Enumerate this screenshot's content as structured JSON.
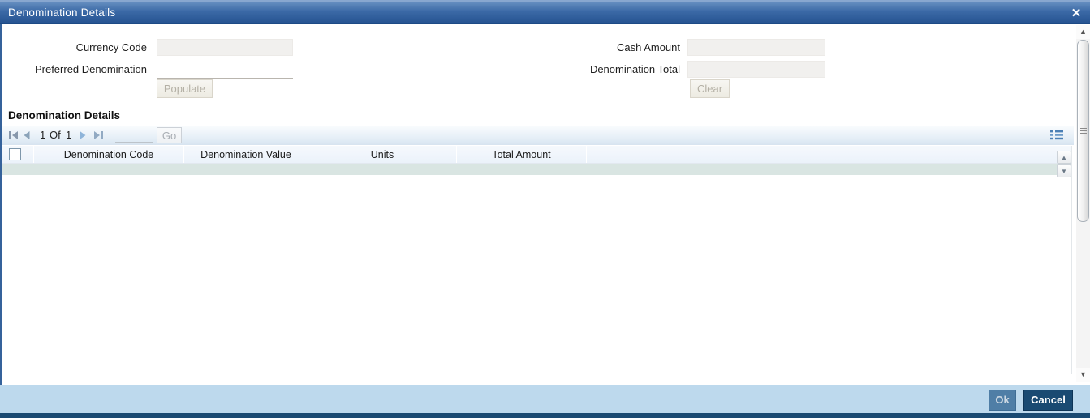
{
  "window": {
    "title": "Denomination Details",
    "close_glyph": "✕"
  },
  "form": {
    "currency_code_label": "Currency Code",
    "currency_code_value": "",
    "preferred_denomination_label": "Preferred Denomination",
    "preferred_denomination_value": "",
    "cash_amount_label": "Cash Amount",
    "cash_amount_value": "",
    "denomination_total_label": "Denomination Total",
    "denomination_total_value": "",
    "populate_button_label": "Populate",
    "clear_button_label": "Clear"
  },
  "details_section": {
    "heading": "Denomination Details",
    "pagination": {
      "current_page": "1",
      "of_label": "Of",
      "total_pages": "1",
      "page_input_value": "",
      "go_button_label": "Go"
    },
    "table": {
      "columns": [
        "Denomination Code",
        "Denomination Value",
        "Units",
        "Total Amount"
      ],
      "rows": []
    },
    "mini_scroll_up_glyph": "▲",
    "mini_scroll_down_glyph": "▼"
  },
  "footer": {
    "ok_button_label": "Ok",
    "cancel_button_label": "Cancel"
  },
  "scrollbar": {
    "up_glyph": "▲",
    "down_glyph": "▼"
  },
  "colors": {
    "titlebar_top": "#6790c1",
    "titlebar_bottom": "#265391",
    "footer_bg": "#bdd9ed",
    "accent_navy": "#1a4a72",
    "ok_button_bg": "#4f7ea6",
    "selected_row_bg": "#d9e5e2",
    "pagination_icon_blue": "#4a7fb5"
  }
}
